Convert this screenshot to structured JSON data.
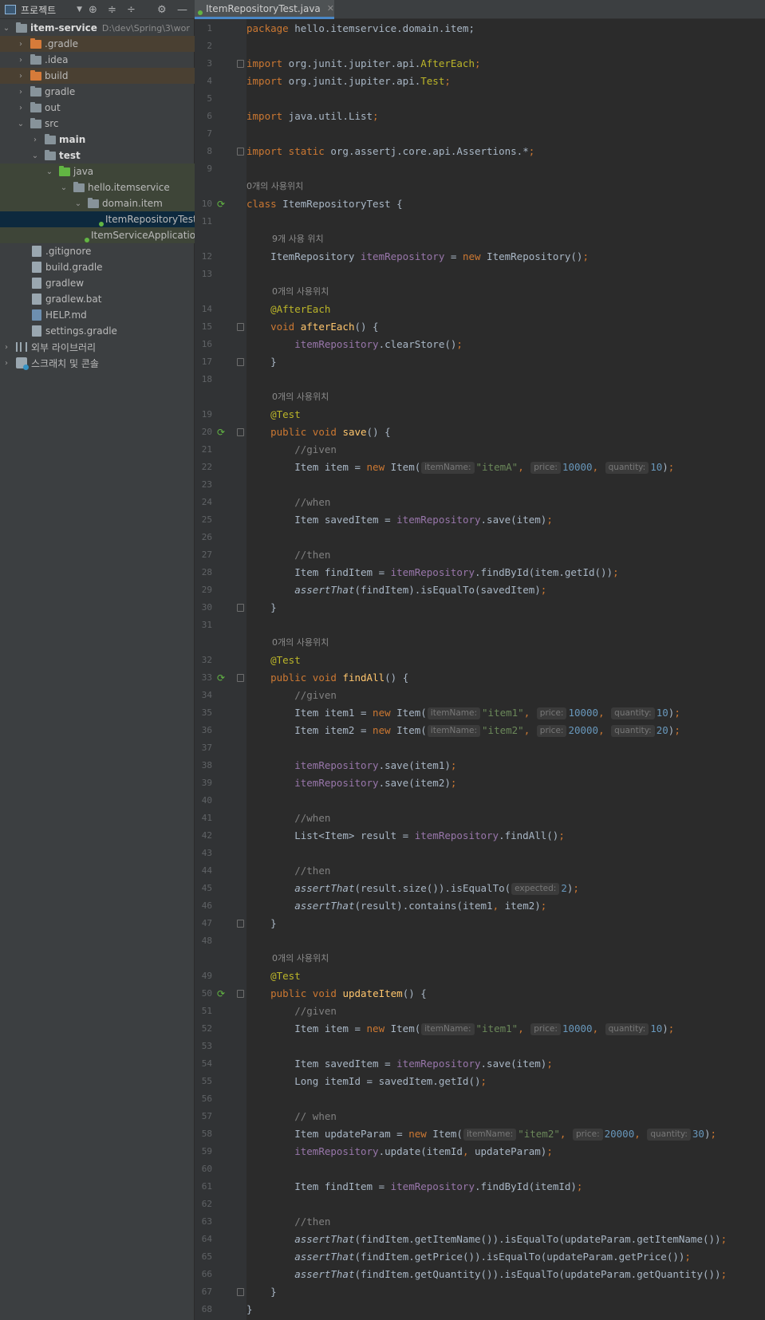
{
  "project_panel": {
    "toolbar": {
      "view_label": "프로젝트"
    },
    "tree": [
      {
        "label": "item-service",
        "hint": "D:\\dev\\Spring\\3\\wor",
        "kind": "module",
        "depth": 0,
        "expanded": true
      },
      {
        "label": ".gradle",
        "kind": "folder-orange",
        "depth": 1,
        "expanded": false
      },
      {
        "label": ".idea",
        "kind": "folder-gray",
        "depth": 1,
        "expanded": false
      },
      {
        "label": "build",
        "kind": "folder-orange",
        "depth": 1,
        "expanded": false
      },
      {
        "label": "gradle",
        "kind": "folder-gray",
        "depth": 1,
        "expanded": false
      },
      {
        "label": "out",
        "kind": "folder-orange",
        "depth": 1,
        "expanded": false
      },
      {
        "label": "src",
        "kind": "folder-gray",
        "depth": 1,
        "expanded": true
      },
      {
        "label": "main",
        "kind": "folder-blue",
        "depth": 2,
        "expanded": false
      },
      {
        "label": "test",
        "kind": "folder-gray",
        "depth": 2,
        "expanded": true
      },
      {
        "label": "java",
        "kind": "folder-green",
        "depth": 3,
        "expanded": true
      },
      {
        "label": "hello.itemservice",
        "kind": "package",
        "depth": 4,
        "expanded": true
      },
      {
        "label": "domain.item",
        "kind": "package",
        "depth": 5,
        "expanded": true
      },
      {
        "label": "ItemRepositoryTest",
        "kind": "class",
        "depth": 6
      },
      {
        "label": "ItemServiceApplicationTests",
        "kind": "class",
        "depth": 5
      },
      {
        "label": ".gitignore",
        "kind": "file",
        "depth": 1
      },
      {
        "label": "build.gradle",
        "kind": "gradle",
        "depth": 1
      },
      {
        "label": "gradlew",
        "kind": "file",
        "depth": 1
      },
      {
        "label": "gradlew.bat",
        "kind": "file",
        "depth": 1
      },
      {
        "label": "HELP.md",
        "kind": "md",
        "depth": 1
      },
      {
        "label": "settings.gradle",
        "kind": "gradle",
        "depth": 1
      },
      {
        "label": "외부 라이브러리",
        "kind": "libs",
        "depth": 0,
        "expanded": false
      },
      {
        "label": "스크래치 및 콘솔",
        "kind": "scratch",
        "depth": 0,
        "expanded": false
      }
    ]
  },
  "editor": {
    "tab_label": "ItemRepositoryTest.java",
    "usages": {
      "class": "0개의 사용위치",
      "field": "9개 사용 위치",
      "afterEach": "0개의 사용위치",
      "save": "0개의 사용위치",
      "findAll": "0개의 사용위치",
      "updateItem": "0개의 사용위치"
    },
    "lines": {
      "l1": "package hello.itemservice.domain.item;",
      "l3a": "import org.junit.jupiter.api.",
      "l3b": "AfterEach",
      "l3c": ";",
      "l4a": "import org.junit.jupiter.api.",
      "l4b": "Test",
      "l4c": ";",
      "l6": "import java.util.List;",
      "l8": "import static org.assertj.core.api.Assertions.*;",
      "l10": "class ItemRepositoryTest {",
      "l12": "ItemRepository itemRepository = new ItemRepository();",
      "l14": "@AfterEach",
      "l15": "void afterEach() {",
      "l16": "itemRepository.clearStore();",
      "l19": "@Test",
      "l20": "public void save() {",
      "l21": "//given",
      "l22": "Item item = new Item( itemName: \"itemA\",  price: 10000,  quantity: 10);",
      "l24": "//when",
      "l25": "Item savedItem = itemRepository.save(item);",
      "l27": "//then",
      "l28": "Item findItem = itemRepository.findById(item.getId());",
      "l29": "assertThat(findItem).isEqualTo(savedItem);",
      "l32": "@Test",
      "l33": "public void findAll() {",
      "l34": "//given",
      "l35": "Item item1 = new Item( itemName: \"item1\",  price: 10000,  quantity: 10);",
      "l36": "Item item2 = new Item( itemName: \"item2\",  price: 20000,  quantity: 20);",
      "l38": "itemRepository.save(item1);",
      "l39": "itemRepository.save(item2);",
      "l41": "//when",
      "l42": "List<Item> result = itemRepository.findAll();",
      "l44": "//then",
      "l45": "assertThat(result.size()).isEqualTo( expected: 2);",
      "l46": "assertThat(result).contains(item1, item2);",
      "l49": "@Test",
      "l50": "public void updateItem() {",
      "l51": "//given",
      "l52": "Item item = new Item( itemName: \"item1\",  price: 10000,  quantity: 10);",
      "l54": "Item savedItem = itemRepository.save(item);",
      "l55": "Long itemId = savedItem.getId();",
      "l57": "// when",
      "l58": "Item updateParam = new Item( itemName: \"item2\",  price: 20000,  quantity: 30);",
      "l59": "itemRepository.update(itemId, updateParam);",
      "l61": "Item findItem = itemRepository.findById(itemId);",
      "l63": "//then",
      "l64": "assertThat(findItem.getItemName()).isEqualTo(updateParam.getItemName());",
      "l65": "assertThat(findItem.getPrice()).isEqualTo(updateParam.getPrice());",
      "l66": "assertThat(findItem.getQuantity()).isEqualTo(updateParam.getQuantity());"
    }
  }
}
